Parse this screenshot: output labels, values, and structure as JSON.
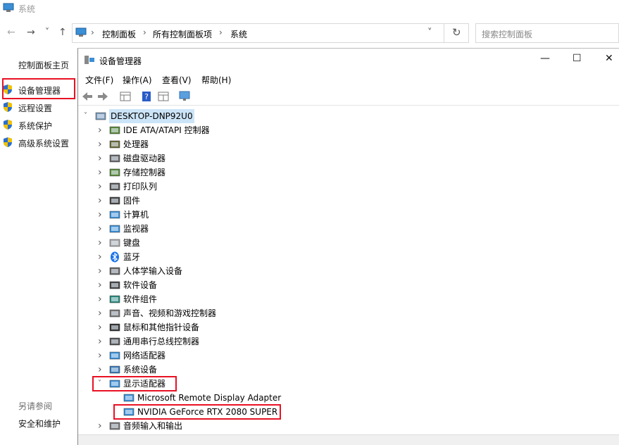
{
  "window": {
    "title": "系统"
  },
  "nav": {
    "back": "←",
    "forward": "→",
    "recent": "˅",
    "up": "↑",
    "crumbs": [
      "控制面板",
      "所有控制面板项",
      "系统"
    ],
    "dropdown": "˅",
    "refresh": "↻",
    "search_placeholder": "搜索控制面板"
  },
  "left_panel": {
    "home": "控制面板主页",
    "items": [
      "设备管理器",
      "远程设置",
      "系统保护",
      "高级系统设置"
    ],
    "see_also": "另请参阅",
    "security": "安全和维护"
  },
  "device_manager": {
    "title": "设备管理器",
    "buttons": {
      "minimize": "—",
      "maximize": "☐",
      "close": "✕"
    },
    "menus": [
      "文件(F)",
      "操作(A)",
      "查看(V)",
      "帮助(H)"
    ],
    "root": "DESKTOP-DNP92U0",
    "categories": [
      "IDE ATA/ATAPI 控制器",
      "处理器",
      "磁盘驱动器",
      "存储控制器",
      "打印队列",
      "固件",
      "计算机",
      "监视器",
      "键盘",
      "蓝牙",
      "人体学输入设备",
      "软件设备",
      "软件组件",
      "声音、视频和游戏控制器",
      "鼠标和其他指针设备",
      "通用串行总线控制器",
      "网络适配器",
      "系统设备",
      "显示适配器"
    ],
    "display_children": [
      "Microsoft Remote Display Adapter",
      "NVIDIA GeForce RTX 2080 SUPER"
    ],
    "last_category": "音频输入和输出",
    "colors": {
      "highlight_border": "#e81123",
      "accent": "#0078d7"
    }
  }
}
